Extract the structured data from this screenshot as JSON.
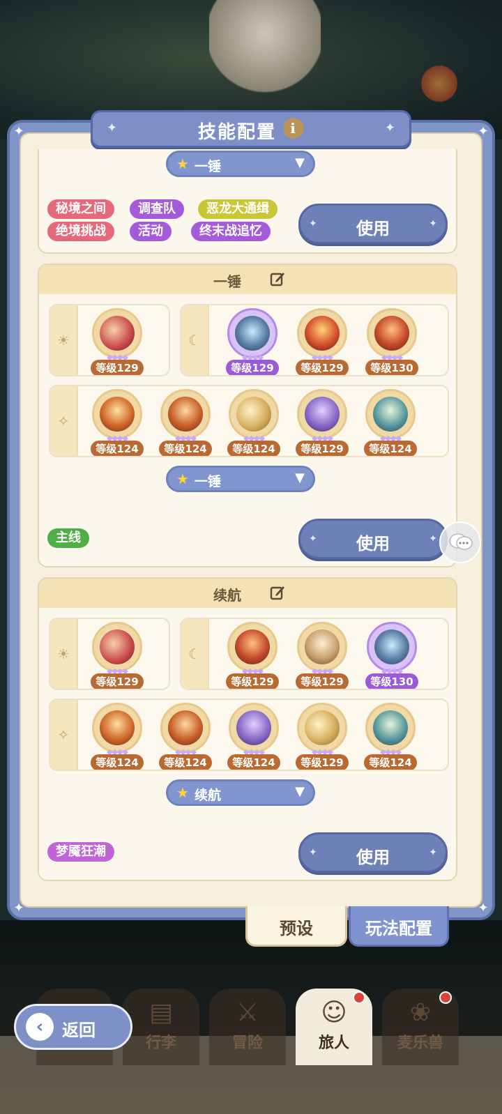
{
  "header": {
    "title": "技能配置"
  },
  "card_top": {
    "dropdown_label": "一锤",
    "use_label": "使用",
    "tags": [
      "秘境之间",
      "调查队",
      "恶龙大通缉",
      "绝境挑战",
      "活动",
      "终末战追忆"
    ]
  },
  "card_1": {
    "name": "一锤",
    "sun_skills": [
      {
        "level": "等级129"
      }
    ],
    "moon_skills": [
      {
        "level": "等级129"
      },
      {
        "level": "等级129"
      },
      {
        "level": "等级130"
      }
    ],
    "star_skills": [
      {
        "level": "等级124"
      },
      {
        "level": "等级124"
      },
      {
        "level": "等级124"
      },
      {
        "level": "等级129"
      },
      {
        "level": "等级124"
      }
    ],
    "dropdown_label": "一锤",
    "use_label": "使用",
    "tags": [
      "主线"
    ]
  },
  "card_2": {
    "name": "续航",
    "sun_skills": [
      {
        "level": "等级129"
      }
    ],
    "moon_skills": [
      {
        "level": "等级129"
      },
      {
        "level": "等级129"
      },
      {
        "level": "等级130"
      }
    ],
    "star_skills": [
      {
        "level": "等级124"
      },
      {
        "level": "等级124"
      },
      {
        "level": "等级124"
      },
      {
        "level": "等级129"
      },
      {
        "level": "等级124"
      }
    ],
    "dropdown_label": "续航",
    "use_label": "使用",
    "tags": [
      "梦魇狂潮"
    ]
  },
  "tabs": {
    "preset": "预设",
    "gameplay": "玩法配置"
  },
  "nav": {
    "back": "返回",
    "bag": "行李",
    "adventure": "冒险",
    "traveler": "旅人",
    "pet": "麦乐兽"
  },
  "colors": {
    "tag_red": "#e5697a",
    "tag_purple": "#a45ad9",
    "tag_yellow": "#c8c736",
    "tag_green": "#4fae45",
    "tag_violet": "#c064d6"
  }
}
